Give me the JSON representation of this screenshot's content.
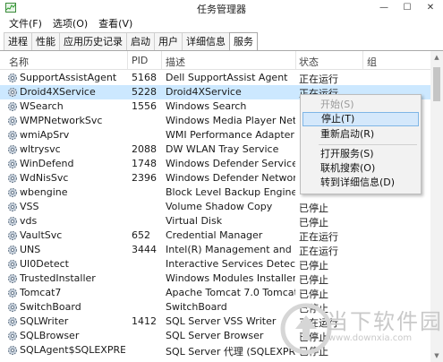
{
  "window": {
    "title": "任务管理器",
    "minimize": "—",
    "maximize": "☐",
    "close": "✕"
  },
  "menu": [
    "文件(F)",
    "选项(O)",
    "查看(V)"
  ],
  "tabs": [
    "进程",
    "性能",
    "应用历史记录",
    "启动",
    "用户",
    "详细信息",
    "服务"
  ],
  "active_tab": "服务",
  "columns": {
    "name": "名称",
    "pid": "PID",
    "desc": "描述",
    "status": "状态",
    "group": "组"
  },
  "rows": [
    {
      "name": "SupportAssistAgent",
      "pid": "5168",
      "desc": "Dell SupportAssist Agent",
      "status": "正在运行"
    },
    {
      "name": "Droid4XService",
      "pid": "5228",
      "desc": "Droid4XService",
      "status": "正在运行"
    },
    {
      "name": "WSearch",
      "pid": "1556",
      "desc": "Windows Search",
      "status": ""
    },
    {
      "name": "WMPNetworkSvc",
      "pid": "",
      "desc": "Windows Media Player Netw...",
      "status": ""
    },
    {
      "name": "wmiApSrv",
      "pid": "",
      "desc": "WMI Performance Adapter",
      "status": ""
    },
    {
      "name": "wltrysvc",
      "pid": "2088",
      "desc": "DW WLAN Tray Service",
      "status": ""
    },
    {
      "name": "WinDefend",
      "pid": "1748",
      "desc": "Windows Defender Service",
      "status": ""
    },
    {
      "name": "WdNisSvc",
      "pid": "2396",
      "desc": "Windows Defender Network I...",
      "status": ""
    },
    {
      "name": "wbengine",
      "pid": "",
      "desc": "Block Level Backup Engine Se...",
      "status": ""
    },
    {
      "name": "VSS",
      "pid": "",
      "desc": "Volume Shadow Copy",
      "status": "已停止"
    },
    {
      "name": "vds",
      "pid": "",
      "desc": "Virtual Disk",
      "status": "已停止"
    },
    {
      "name": "VaultSvc",
      "pid": "652",
      "desc": "Credential Manager",
      "status": "正在运行"
    },
    {
      "name": "UNS",
      "pid": "3444",
      "desc": "Intel(R) Management and Sec...",
      "status": "正在运行"
    },
    {
      "name": "UI0Detect",
      "pid": "",
      "desc": "Interactive Services Detection",
      "status": "已停止"
    },
    {
      "name": "TrustedInstaller",
      "pid": "",
      "desc": "Windows Modules Installer",
      "status": "已停止"
    },
    {
      "name": "Tomcat7",
      "pid": "",
      "desc": "Apache Tomcat 7.0 Tomcat7",
      "status": "已停止"
    },
    {
      "name": "SwitchBoard",
      "pid": "",
      "desc": "SwitchBoard",
      "status": "已停止"
    },
    {
      "name": "SQLWriter",
      "pid": "1412",
      "desc": "SQL Server VSS Writer",
      "status": "正在运行"
    },
    {
      "name": "SQLBrowser",
      "pid": "",
      "desc": "SQL Server Browser",
      "status": "已停止"
    },
    {
      "name": "SQLAgent$SQLEXPRESS",
      "pid": "",
      "desc": "SQL Server 代理 (SQLEXPRESS)",
      "status": "已停止"
    }
  ],
  "context_menu": {
    "start": "开始(S)",
    "stop": "停止(T)",
    "restart": "重新启动(R)",
    "open_services": "打开服务(S)",
    "search_online": "联机搜索(O)",
    "goto_details": "转到详细信息(D)"
  },
  "watermark": {
    "brand": "当下软件园",
    "url": "www.downxia.com"
  },
  "colors": {
    "selected_row": "#cce8ff",
    "menu_hover": "#d4e8fb",
    "menu_bg": "#f2f2f2"
  }
}
